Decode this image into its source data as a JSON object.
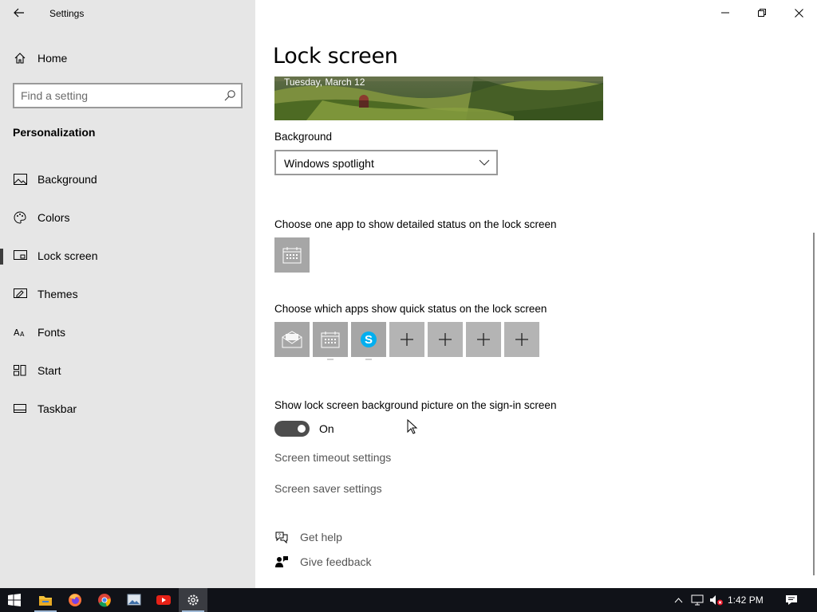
{
  "window": {
    "title": "Settings",
    "back_icon": "back-arrow-icon",
    "controls": [
      "minimize-icon",
      "restore-icon",
      "close-icon"
    ]
  },
  "sidebar": {
    "home_label": "Home",
    "search_placeholder": "Find a setting",
    "section_title": "Personalization",
    "items": [
      {
        "label": "Background",
        "icon": "picture-icon",
        "selected": false
      },
      {
        "label": "Colors",
        "icon": "palette-icon",
        "selected": false
      },
      {
        "label": "Lock screen",
        "icon": "lock-screen-icon",
        "selected": true
      },
      {
        "label": "Themes",
        "icon": "themes-icon",
        "selected": false
      },
      {
        "label": "Fonts",
        "icon": "fonts-icon",
        "selected": false
      },
      {
        "label": "Start",
        "icon": "start-icon",
        "selected": false
      },
      {
        "label": "Taskbar",
        "icon": "taskbar-icon",
        "selected": false
      }
    ]
  },
  "main": {
    "page_title": "Lock screen",
    "preview_date": "Tuesday, March 12",
    "background_label": "Background",
    "background_value": "Windows spotlight",
    "detailed_status_label": "Choose one app to show detailed status on the lock screen",
    "detailed_status_app": "calendar-icon",
    "quick_status_label": "Choose which apps show quick status on the lock screen",
    "quick_status_apps": [
      "mail-icon",
      "calendar-icon",
      "skype-icon",
      "plus-icon",
      "plus-icon",
      "plus-icon",
      "plus-icon"
    ],
    "signin_label": "Show lock screen background picture on the sign-in screen",
    "signin_toggle_on": true,
    "signin_toggle_text": "On",
    "timeout_link": "Screen timeout settings",
    "saver_link": "Screen saver settings",
    "help_label": "Get help",
    "feedback_label": "Give feedback"
  },
  "taskbar": {
    "apps": [
      "windows-start-icon",
      "file-explorer-icon",
      "firefox-icon",
      "chrome-icon",
      "photos-icon",
      "youtube-icon",
      "settings-icon"
    ],
    "active_app": "settings-icon",
    "tray_icons": [
      "chevron-up-icon",
      "network-icon",
      "volume-muted-icon"
    ],
    "clock": "1:42 PM",
    "notification_icon": "action-center-icon"
  },
  "colors": {
    "sidebar_bg": "#e6e6e6",
    "taskbar_bg": "#101218",
    "tile_bg": "#a6a6a6",
    "toggle_on": "#4d4d4d",
    "skype_blue": "#00aff0"
  }
}
